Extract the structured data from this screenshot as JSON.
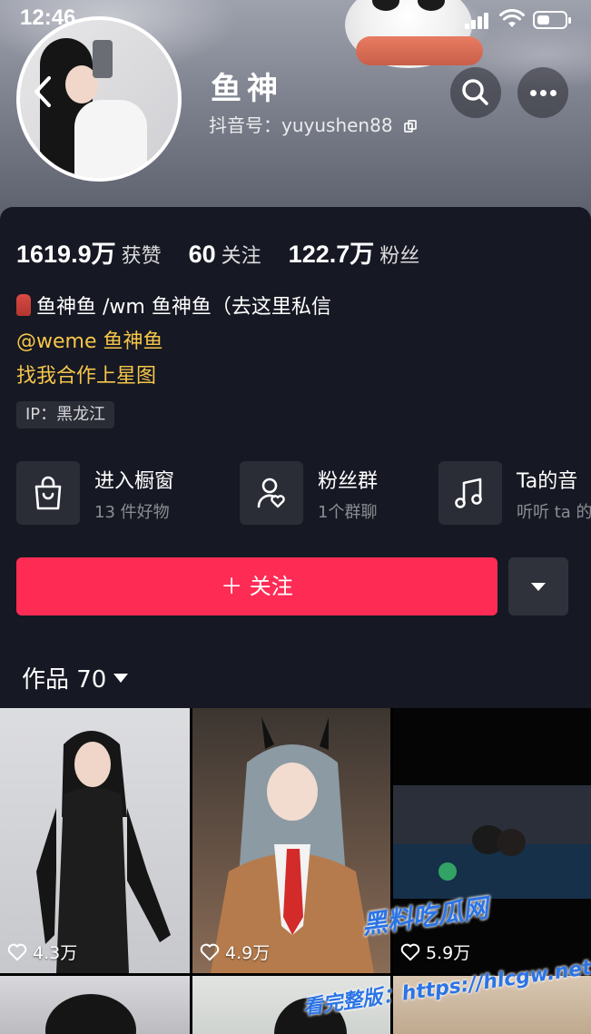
{
  "status_bar": {
    "time": "12:46",
    "battery_level": 0.45
  },
  "profile": {
    "name": "鱼神",
    "douyin_id": "抖音号：yuyushen88"
  },
  "stats": [
    {
      "value": "1619.9万",
      "label": "获赞"
    },
    {
      "value": "60",
      "label": "关注"
    },
    {
      "value": "122.7万",
      "label": "粉丝"
    }
  ],
  "bio": {
    "line1": "鱼神鱼 /wm 鱼神鱼（去这里私信",
    "line2": "@weme 鱼神鱼",
    "line3": "找我合作上星图",
    "ip": "IP：黑龙江"
  },
  "features": [
    {
      "title": "进入橱窗",
      "subtitle": "13 件好物",
      "icon": "shopping-bag-icon"
    },
    {
      "title": "粉丝群",
      "subtitle": "1个群聊",
      "icon": "fan-group-icon"
    },
    {
      "title": "Ta的音",
      "subtitle": "听听 ta 的",
      "icon": "music-note-icon"
    }
  ],
  "actions": {
    "follow_label": "＋ 关注"
  },
  "works": {
    "label": "作品 70"
  },
  "videos": [
    {
      "likes": "4.3万"
    },
    {
      "likes": "4.9万"
    },
    {
      "likes": "5.9万"
    }
  ],
  "watermark": {
    "line1": "黑料吃瓜网",
    "line2": "看完整版：https://hlcgw.net"
  },
  "colors": {
    "accent": "#fe2c55",
    "background": "#161823",
    "highlight": "#f6c64a"
  }
}
